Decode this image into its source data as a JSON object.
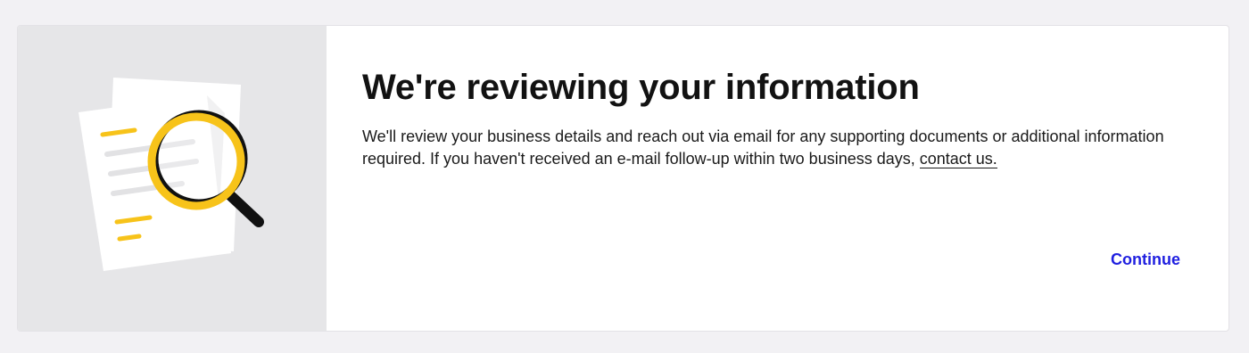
{
  "dialog": {
    "title": "We're reviewing your information",
    "message_before_link": "We'll review your business details and reach out via email for any supporting documents or additional information required. If you haven't received an e-mail follow-up within two business days, ",
    "link_text": "contact us.",
    "continue_label": "Continue"
  },
  "illustration": {
    "icon": "document-magnifier-icon",
    "colors": {
      "panel_bg": "#e6e6e8",
      "accent_yellow": "#f7c31a",
      "handle_dark": "#111111",
      "paper": "#ffffff",
      "paper_lines": "#e2e2e4"
    }
  },
  "colors": {
    "page_bg": "#f2f1f4",
    "link_blue": "#1f1fe0",
    "title_text": "#121212"
  }
}
